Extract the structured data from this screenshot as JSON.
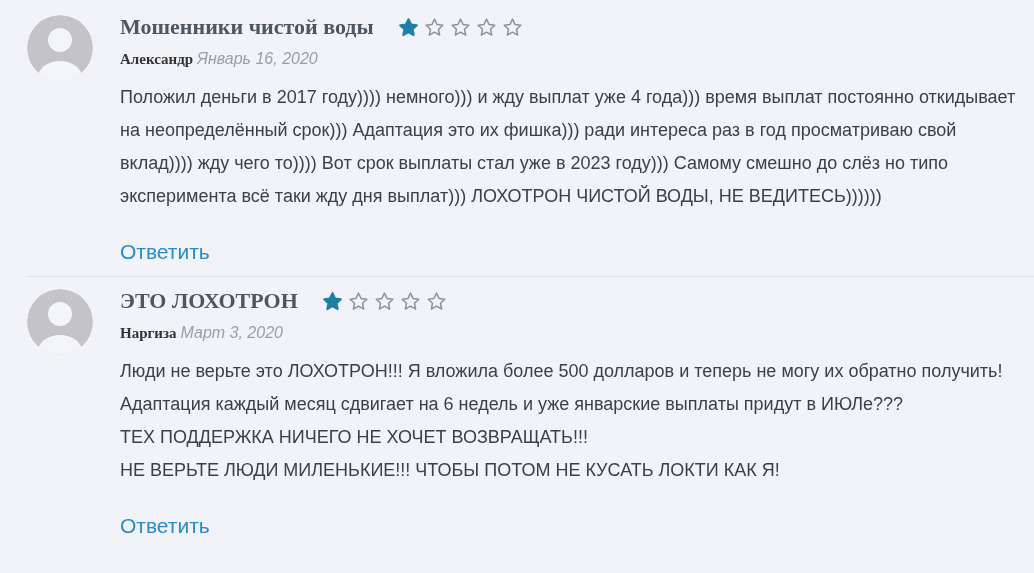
{
  "reviews": [
    {
      "title": "Мошенники чистой воды",
      "stars": 1,
      "author": "Александр",
      "date": "Январь 16, 2020",
      "body": "Положил деньги в 2017 году)))) немного))) и жду выплат уже 4 года))) время выплат постоянно откидывает на неопределённый срок))) Адаптация это их фишка))) ради интереса раз в год просматриваю свой вклад)))) жду чего то)))) Вот срок выплаты стал уже в 2023 году))) Самому смешно до слёз но типо эксперимента всё таки жду дня выплат))) ЛОХОТРОН ЧИСТОЙ ВОДЫ, НЕ ВЕДИТЕСЬ))))))",
      "reply": "Ответить"
    },
    {
      "title": "ЭТО ЛОХОТРОН",
      "stars": 1,
      "author": "Наргиза",
      "date": "Март 3, 2020",
      "body": "Люди не верьте это ЛОХОТРОН!!! Я вложила более 500 долларов и теперь не могу их обратно получить! Адаптация каждый месяц сдвигает на 6 недель и уже январские выплаты придут в ИЮЛе???\nТЕХ ПОДДЕРЖКА НИЧЕГО НЕ ХОЧЕТ ВОЗВРАЩАТЬ!!!\nНЕ ВЕРЬТЕ ЛЮДИ МИЛЕНЬКИЕ!!! ЧТОБЫ ПОТОМ НЕ КУСАТЬ ЛОКТИ КАК Я!",
      "reply": "Ответить"
    }
  ]
}
